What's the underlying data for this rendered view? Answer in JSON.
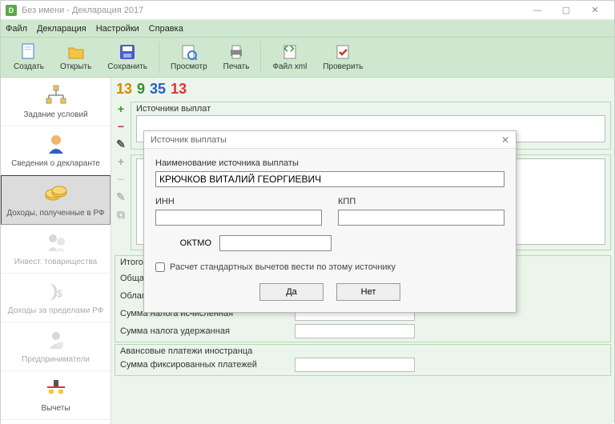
{
  "window": {
    "title": "Без имени - Декларация 2017"
  },
  "menu": {
    "file": "Файл",
    "decl": "Декларация",
    "settings": "Настройки",
    "help": "Справка"
  },
  "toolbar": {
    "create": "Создать",
    "open": "Открыть",
    "save": "Сохранить",
    "view": "Просмотр",
    "print": "Печать",
    "xml": "Файл xml",
    "check": "Проверить"
  },
  "digits": {
    "a": "13",
    "b": "9",
    "c": "35",
    "d": "13"
  },
  "sidebar": {
    "conditions": "Задание условий",
    "declarant": "Сведения о декларанте",
    "income_rf": "Доходы, полученные в РФ",
    "invest": "Инвест. товарищества",
    "foreign": "Доходы за пределами РФ",
    "entrepreneurs": "Предприниматели",
    "deductions": "Вычеты"
  },
  "panels": {
    "sources": "Источники выплат",
    "totals_header": "Итоговые суммы по источнику выплат",
    "total1": "Общая сумма дохода",
    "total2": "Облагаемая сумма дохода",
    "total3": "Сумма налога исчисленная",
    "total4": "Сумма налога удержанная",
    "advance_header": "Авансовые платежи иностранца",
    "advance1": "Сумма фиксированных платежей"
  },
  "modal": {
    "title": "Источник выплаты",
    "name_label": "Наименование источника выплаты",
    "name_value": "КРЮЧКОВ ВИТАЛИЙ ГЕОРГИЕВИЧ",
    "inn": "ИНН",
    "kpp": "КПП",
    "oktmo": "ОКТМО",
    "checkbox": "Расчет стандартных вычетов вести по этому источнику",
    "yes": "Да",
    "no": "Нет"
  }
}
